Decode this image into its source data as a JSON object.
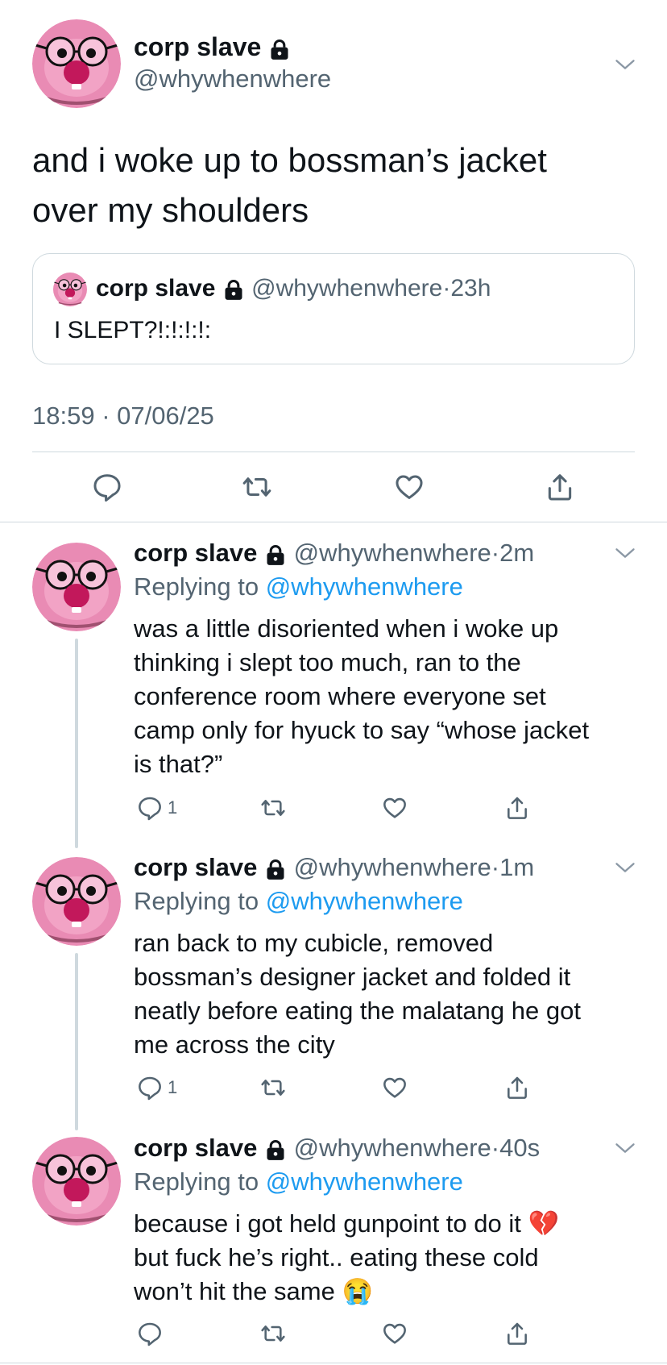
{
  "main": {
    "name": "corp slave",
    "handle": "@whywhenwhere",
    "text_line1": "and i woke up to bossman’s jacket",
    "text_line2": "over my shoulders",
    "quote": {
      "name": "corp slave",
      "handle": "@whywhenwhere",
      "sep": "·",
      "time": "23h",
      "text": "I SLEPT?!:!:!:!:"
    },
    "timestamp": "18:59 · 07/06/25"
  },
  "replies": [
    {
      "name": "corp slave",
      "handle": "@whywhenwhere",
      "sep": "·",
      "time": "2m",
      "replying_prefix": "Replying to",
      "replying_handle": "@whywhenwhere",
      "lines": [
        "was a little disoriented when i woke up",
        "thinking i slept too much, ran to the",
        "conference room where everyone set",
        "camp only for hyuck to say “whose jacket",
        "is that?”"
      ],
      "reply_count": "1"
    },
    {
      "name": "corp slave",
      "handle": "@whywhenwhere",
      "sep": "·",
      "time": "1m",
      "replying_prefix": "Replying to",
      "replying_handle": "@whywhenwhere",
      "lines": [
        "ran back to my cubicle, removed",
        "bossman’s designer jacket and folded it",
        "neatly before eating the malatang he got",
        "me across the city"
      ],
      "reply_count": "1"
    },
    {
      "name": "corp slave",
      "handle": "@whywhenwhere",
      "sep": "·",
      "time": "40s",
      "replying_prefix": "Replying to",
      "replying_handle": "@whywhenwhere",
      "lines": [
        "because i got held gunpoint to do it 💔",
        "but fuck he’s right.. eating these cold",
        "won’t hit the same 😭"
      ],
      "reply_count": ""
    }
  ],
  "icons": [
    "lock-icon",
    "chevron-down-icon",
    "reply-icon",
    "retweet-icon",
    "like-icon",
    "share-icon"
  ],
  "colors": {
    "link": "#1d9bf0",
    "muted": "#536471",
    "divider": "#cfd9de",
    "avatar_pink": "#e98bb4"
  }
}
